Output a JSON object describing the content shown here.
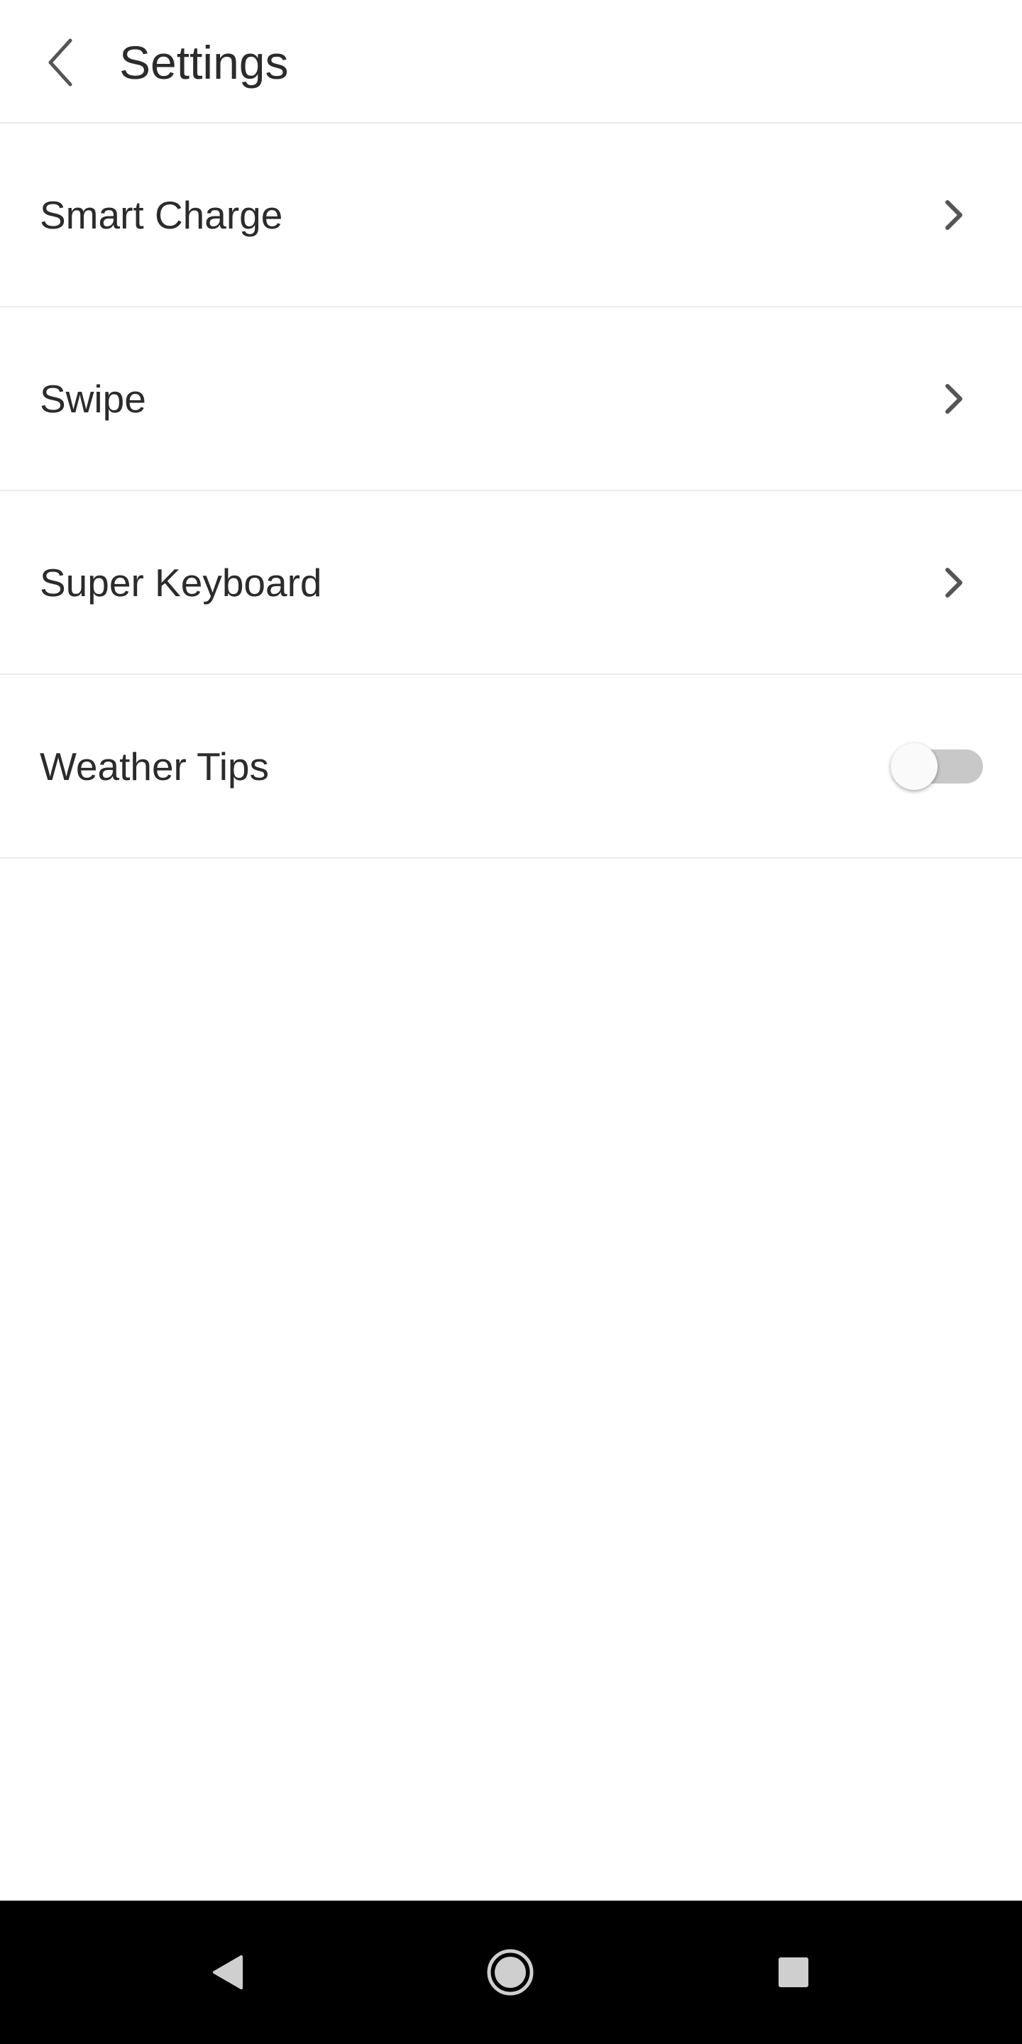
{
  "header": {
    "title": "Settings",
    "back_icon": "chevron-left-icon"
  },
  "items": [
    {
      "label": "Smart Charge",
      "control": "chevron"
    },
    {
      "label": "Swipe",
      "control": "chevron"
    },
    {
      "label": "Super Keyboard",
      "control": "chevron"
    },
    {
      "label": "Weather Tips",
      "control": "toggle",
      "toggle_on": false
    }
  ],
  "colors": {
    "text": "#2b2b2b",
    "divider": "#ebebeb",
    "chevron": "#555555",
    "toggle_track_off": "#c8c8c8",
    "nav_bar": "#000000",
    "nav_icons": "#cfcfcf"
  },
  "nav_bar": {
    "icons": [
      "nav-back-icon",
      "nav-home-icon",
      "nav-recents-icon"
    ]
  }
}
